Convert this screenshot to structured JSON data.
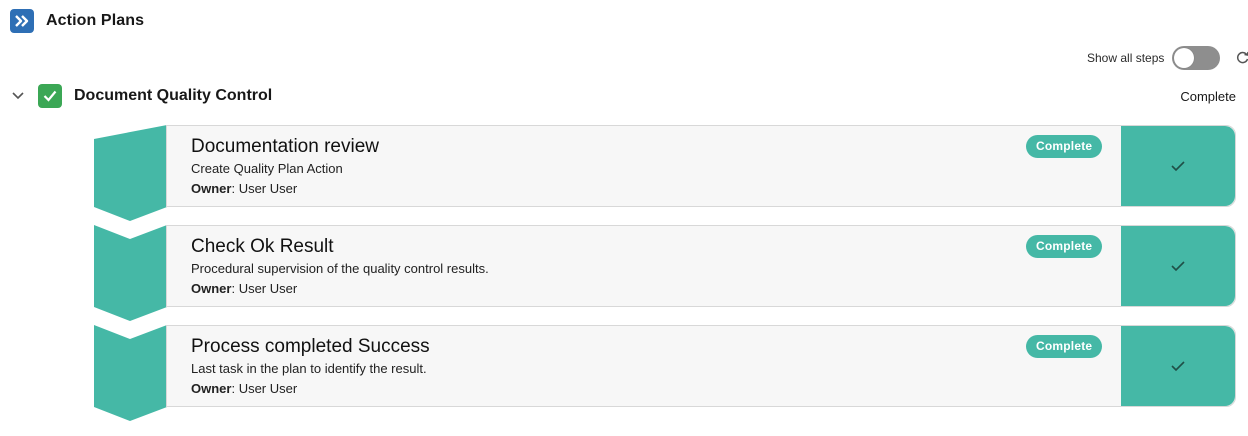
{
  "header": {
    "title": "Action Plans",
    "icon": "double-chevron-right-icon"
  },
  "toolbar": {
    "show_all_steps_label": "Show all steps",
    "show_all_steps_on": false,
    "refresh_icon": "refresh-icon"
  },
  "plan": {
    "title": "Document Quality Control",
    "status": "Complete",
    "expanded": true
  },
  "colors": {
    "step_accent": "#45b8a6",
    "plan_check": "#3ba755",
    "app_icon": "#2e6fb5",
    "toggle_off": "#8e8e8e"
  },
  "steps": [
    {
      "title": "Documentation review",
      "description": "Create Quality Plan Action",
      "owner_label": "Owner",
      "owner": ": User User",
      "status": "Complete"
    },
    {
      "title": "Check Ok Result",
      "description": "Procedural supervision of the quality control results.",
      "owner_label": "Owner",
      "owner": ": User User",
      "status": "Complete"
    },
    {
      "title": "Process completed Success",
      "description": "Last task in the plan to identify the result.",
      "owner_label": "Owner",
      "owner": ": User User",
      "status": "Complete"
    }
  ]
}
